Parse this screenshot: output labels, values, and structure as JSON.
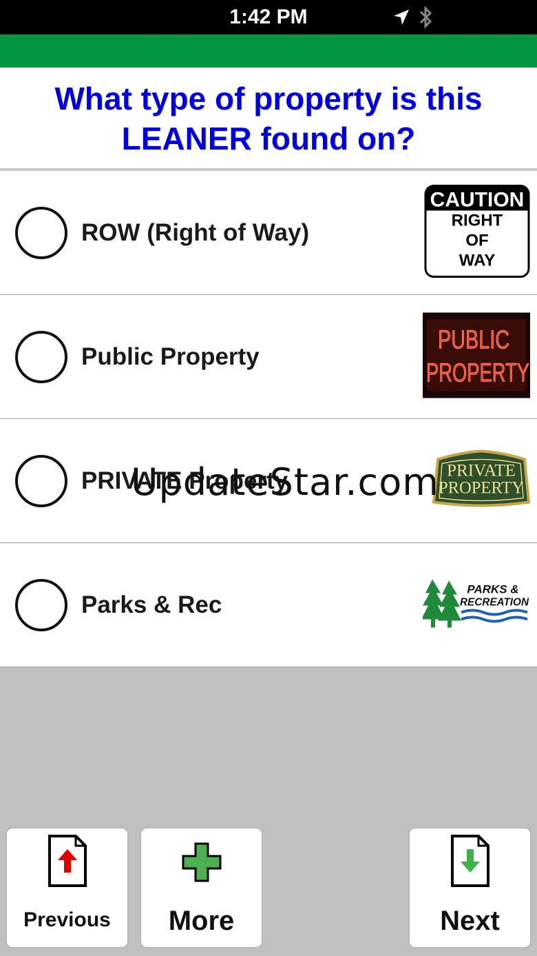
{
  "status": {
    "time": "1:42 PM"
  },
  "question": {
    "line1": "What type of property is this",
    "line2": "LEANER found on?"
  },
  "options": [
    {
      "label": "ROW (Right of Way)",
      "image": "caution-right-of-way-sign",
      "sign_lines": [
        "CAUTION",
        "RIGHT",
        "OF",
        "WAY"
      ]
    },
    {
      "label": "Public Property",
      "image": "public-property-neon-sign",
      "sign_lines": [
        "PUBLIC",
        "PROPERTY"
      ]
    },
    {
      "label": "PRIVATE Property",
      "image": "private-property-plaque",
      "sign_lines": [
        "PRIVATE",
        "PROPERTY"
      ]
    },
    {
      "label": "Parks & Rec",
      "image": "parks-recreation-logo",
      "sign_lines": [
        "PARKS &",
        "RECREATION"
      ]
    }
  ],
  "watermark": "UpdateStar.com",
  "buttons": {
    "previous": "Previous",
    "more": "More",
    "next": "Next"
  },
  "colors": {
    "header_green": "#009640",
    "question_blue": "#0000e6",
    "background_gray": "#c0c0c0"
  }
}
